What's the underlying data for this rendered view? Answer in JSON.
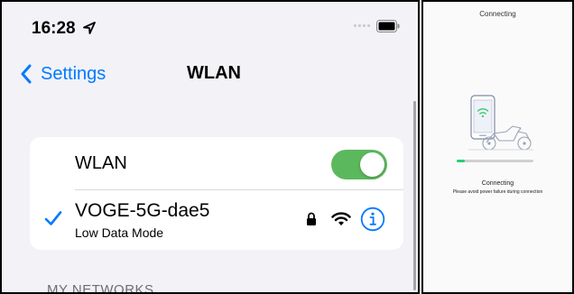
{
  "status_bar": {
    "time": "16:28",
    "location_icon": "location-arrow-icon",
    "battery_icon": "battery-icon"
  },
  "nav": {
    "back_label": "Settings",
    "title": "WLAN"
  },
  "wlan_card": {
    "label": "WLAN",
    "toggle_on": true,
    "toggle_color": "#5cb85c",
    "network": {
      "name": "VOGE-5G-dae5",
      "subtitle": "Low Data Mode",
      "connected": true,
      "icons": [
        "checkmark-icon",
        "lock-icon",
        "wifi-icon",
        "info-icon"
      ]
    }
  },
  "section_header": "MY NETWORKS",
  "connecting_panel": {
    "title": "Connecting",
    "status": "Connecting",
    "note": "Please avoid power failure during connection",
    "progress_fraction": 0.1,
    "accent_color": "#2ecc71",
    "illustration": "phone-motorcycle-illustration"
  },
  "colors": {
    "ios_blue": "#007aff",
    "background": "#f2f2f7"
  }
}
